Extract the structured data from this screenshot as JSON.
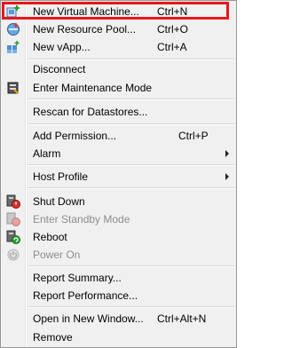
{
  "menu": {
    "items": [
      {
        "label": "New Virtual Machine...",
        "shortcut": "Ctrl+N",
        "icon": "new-vm-icon"
      },
      {
        "label": "New Resource Pool...",
        "shortcut": "Ctrl+O",
        "icon": "resource-pool-icon"
      },
      {
        "label": "New vApp...",
        "shortcut": "Ctrl+A",
        "icon": "vapp-icon"
      },
      {
        "label": "Disconnect"
      },
      {
        "label": "Enter Maintenance Mode",
        "icon": "maintenance-icon"
      },
      {
        "label": "Rescan for Datastores..."
      },
      {
        "label": "Add Permission...",
        "shortcut": "Ctrl+P"
      },
      {
        "label": "Alarm",
        "submenu": true
      },
      {
        "label": "Host Profile",
        "submenu": true
      },
      {
        "label": "Shut Down",
        "icon": "shutdown-icon"
      },
      {
        "label": "Enter Standby Mode",
        "icon": "standby-icon",
        "disabled": true
      },
      {
        "label": "Reboot",
        "icon": "reboot-icon"
      },
      {
        "label": "Power On",
        "icon": "power-on-icon",
        "disabled": true
      },
      {
        "label": "Report Summary..."
      },
      {
        "label": "Report Performance..."
      },
      {
        "label": "Open in New Window...",
        "shortcut": "Ctrl+Alt+N"
      },
      {
        "label": "Remove"
      }
    ]
  }
}
